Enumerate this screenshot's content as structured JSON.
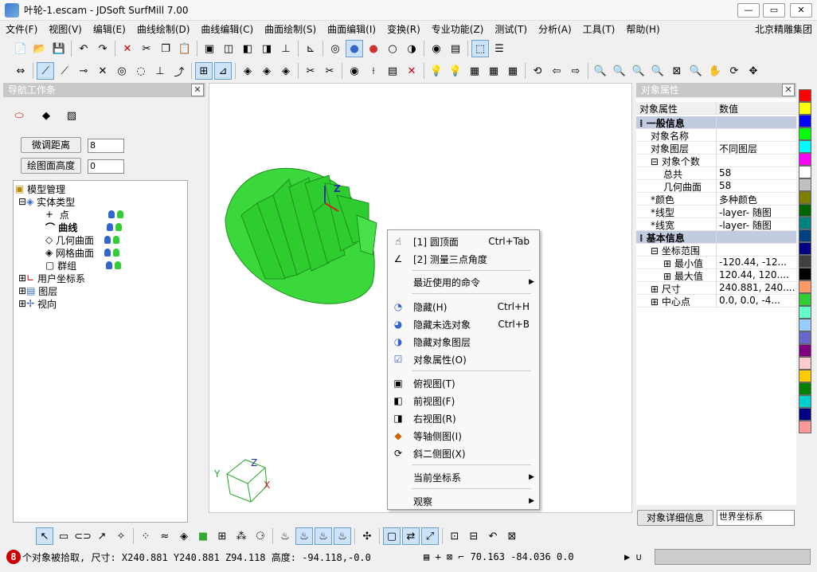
{
  "window": {
    "title": "叶轮-1.escam - JDSoft SurfMill 7.00"
  },
  "menu": [
    "文件(F)",
    "视图(V)",
    "编辑(E)",
    "曲线绘制(D)",
    "曲线编辑(C)",
    "曲面绘制(S)",
    "曲面编辑(I)",
    "变换(R)",
    "专业功能(Z)",
    "测试(T)",
    "分析(A)",
    "工具(T)",
    "帮助(H)"
  ],
  "brand": "北京精雕集团",
  "nav": {
    "title": "导航工作条",
    "btn1": "微调距离",
    "val1": "8",
    "btn2": "绘图面高度",
    "val2": "0",
    "tree": [
      "模型管理",
      "实体类型",
      "点",
      "曲线",
      "几何曲面",
      "网格曲面",
      "群组",
      "用户坐标系",
      "图层",
      "视向"
    ]
  },
  "axis": {
    "z": "Z",
    "y": "Y",
    "x": "X"
  },
  "context": [
    {
      "label": "[1] 圆顶面",
      "shortcut": "Ctrl+Tab",
      "icon": "hand-icon"
    },
    {
      "label": "[2] 测量三点角度",
      "shortcut": "",
      "icon": "angle-icon"
    },
    {
      "label": "最近使用的命令",
      "shortcut": "",
      "icon": ""
    },
    {
      "label": "隐藏(H)",
      "shortcut": "Ctrl+H",
      "icon": "hide-icon"
    },
    {
      "label": "隐藏未选对象",
      "shortcut": "Ctrl+B",
      "icon": "hide-unselected-icon"
    },
    {
      "label": "隐藏对象图层",
      "shortcut": "",
      "icon": "hide-layer-icon"
    },
    {
      "label": "对象属性(O)",
      "shortcut": "",
      "icon": "properties-icon"
    },
    {
      "label": "俯视图(T)",
      "shortcut": "",
      "icon": "top-view-icon"
    },
    {
      "label": "前视图(F)",
      "shortcut": "",
      "icon": "front-view-icon"
    },
    {
      "label": "右视图(R)",
      "shortcut": "",
      "icon": "right-view-icon"
    },
    {
      "label": "等轴侧图(I)",
      "shortcut": "",
      "icon": "iso-view-icon"
    },
    {
      "label": "斜二侧图(X)",
      "shortcut": "",
      "icon": "oblique-view-icon"
    },
    {
      "label": "当前坐标系",
      "shortcut": "",
      "icon": ""
    },
    {
      "label": "观察",
      "shortcut": "",
      "icon": ""
    }
  ],
  "props": {
    "title": "对象属性",
    "col1": "对象属性",
    "col2": "数值",
    "rows": [
      {
        "k": "一般信息",
        "v": "",
        "sect": true
      },
      {
        "k": "对象名称",
        "v": ""
      },
      {
        "k": "对象图层",
        "v": "不同图层"
      },
      {
        "k": "⊟ 对象个数",
        "v": ""
      },
      {
        "k": "总共",
        "v": "58"
      },
      {
        "k": "几何曲面",
        "v": "58"
      },
      {
        "k": "*颜色",
        "v": "多种颜色"
      },
      {
        "k": "*线型",
        "v": "-layer- 随图"
      },
      {
        "k": "*线宽",
        "v": "-layer- 随图"
      },
      {
        "k": "基本信息",
        "v": "",
        "sect": true
      },
      {
        "k": "⊟ 坐标范围",
        "v": ""
      },
      {
        "k": "⊞ 最小值",
        "v": "-120.44, -12..."
      },
      {
        "k": "⊞ 最大值",
        "v": "120.44, 120...."
      },
      {
        "k": "⊞ 尺寸",
        "v": "240.881, 240...."
      },
      {
        "k": "⊞ 中心点",
        "v": "0.0, 0.0, -4..."
      }
    ],
    "tab1": "对象详细信息",
    "tab2": "世界坐标系"
  },
  "palette": [
    "#ff0000",
    "#ffff00",
    "#0000ff",
    "#00ff00",
    "#00ffff",
    "#ff00ff",
    "#ffffff",
    "#c0c0c0",
    "#808000",
    "#006400",
    "#008080",
    "#004080",
    "#000080",
    "#404040",
    "#000000",
    "#ff9966",
    "#33cc33",
    "#66ffcc",
    "#99ccff",
    "#6666cc",
    "#800080",
    "#ffcccc",
    "#ffcc00",
    "#008000",
    "#00cccc",
    "#000080",
    "#ff9999"
  ],
  "status": {
    "count": "8",
    "text": "个对象被拾取, 尺寸: X240.881 Y240.881 Z94.118 高度: -94.118,-0.0",
    "coords": "70.163 -84.036 0.0"
  }
}
